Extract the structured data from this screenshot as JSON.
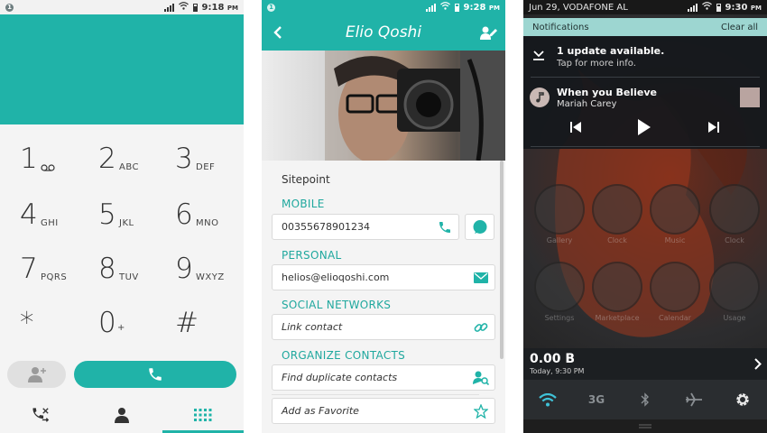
{
  "dialer": {
    "status": {
      "badge": "1",
      "time": "9:18",
      "ampm": "PM"
    },
    "keys": [
      {
        "num": "1",
        "sub": ""
      },
      {
        "num": "2",
        "sub": "ABC"
      },
      {
        "num": "3",
        "sub": "DEF"
      },
      {
        "num": "4",
        "sub": "GHI"
      },
      {
        "num": "5",
        "sub": "JKL"
      },
      {
        "num": "6",
        "sub": "MNO"
      },
      {
        "num": "7",
        "sub": "PQRS"
      },
      {
        "num": "8",
        "sub": "TUV"
      },
      {
        "num": "9",
        "sub": "WXYZ"
      },
      {
        "num": "*",
        "sub": ""
      },
      {
        "num": "0",
        "sub": "+"
      },
      {
        "num": "#",
        "sub": ""
      }
    ],
    "tabs": [
      "call-log",
      "contacts",
      "keypad"
    ],
    "accent": "#20b3a8"
  },
  "contact": {
    "status": {
      "badge": "1",
      "time": "9:28",
      "ampm": "PM"
    },
    "name": "Elio Qoshi",
    "org": "Sitepoint",
    "sections": {
      "mobile": "MOBILE",
      "personal": "PERSONAL",
      "social": "SOCIAL NETWORKS",
      "organize": "ORGANIZE CONTACTS"
    },
    "phone": "00355678901234",
    "email": "helios@elioqoshi.com",
    "link_contact": "Link contact",
    "find_duplicates": "Find duplicate contacts",
    "add_favorite": "Add as Favorite"
  },
  "notifications": {
    "status": {
      "date": "Jun 29, VODAFONE AL",
      "time": "9:30",
      "ampm": "PM"
    },
    "bar_title": "Notifications",
    "clear_all": "Clear all",
    "update": {
      "title": "1 update available.",
      "sub": "Tap for more info."
    },
    "media": {
      "title": "When you Believe",
      "artist": "Mariah Carey"
    },
    "apps": [
      "Gallery",
      "Clock",
      "Music",
      "Clock",
      "Settings",
      "Marketplace",
      "Calendar",
      "Usage"
    ],
    "data_usage": {
      "value": "0.00 B",
      "sub": "Today, 9:30 PM"
    },
    "quick_settings": [
      "wifi",
      "3G",
      "bluetooth",
      "airplane",
      "settings"
    ],
    "quick_3g": "3G"
  }
}
